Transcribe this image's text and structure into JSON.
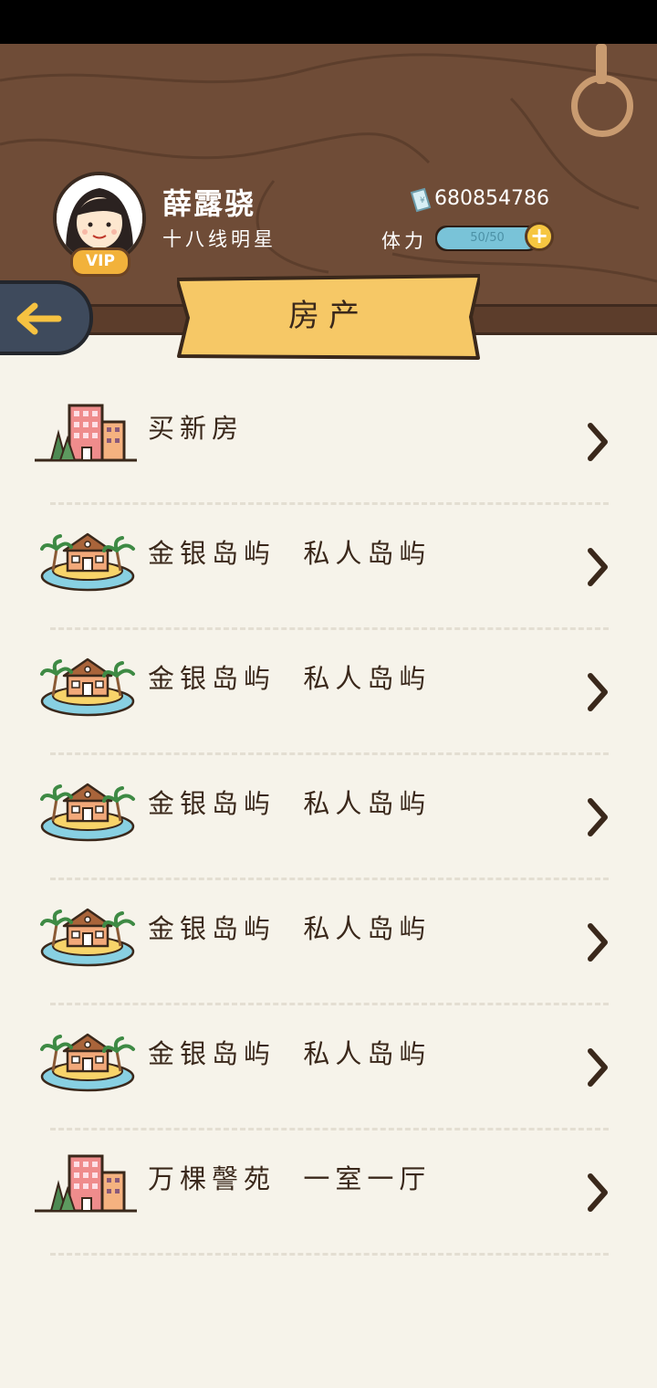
{
  "player": {
    "name": "薛露骁",
    "title": "十八线明星",
    "vip_label": "VIP",
    "money": "680854786",
    "stamina_label": "体力",
    "stamina_text": "50/50",
    "stamina_fraction": 1.0,
    "stamina_add": "+"
  },
  "page": {
    "title": "房产"
  },
  "properties": [
    {
      "icon": "apartment-building-icon",
      "title": "买新房"
    },
    {
      "icon": "island-house-icon",
      "title": "金银岛屿  私人岛屿"
    },
    {
      "icon": "island-house-icon",
      "title": "金银岛屿  私人岛屿"
    },
    {
      "icon": "island-house-icon",
      "title": "金银岛屿  私人岛屿"
    },
    {
      "icon": "island-house-icon",
      "title": "金银岛屿  私人岛屿"
    },
    {
      "icon": "island-house-icon",
      "title": "金银岛屿  私人岛屿"
    },
    {
      "icon": "apartment-building-icon",
      "title": "万棵謦苑  一室一厅"
    }
  ],
  "colors": {
    "wood": "#6f4c37",
    "banner": "#f6c866",
    "background": "#f6f3ea",
    "stamina": "#79c3d8",
    "back_button": "#3e4a5c"
  }
}
